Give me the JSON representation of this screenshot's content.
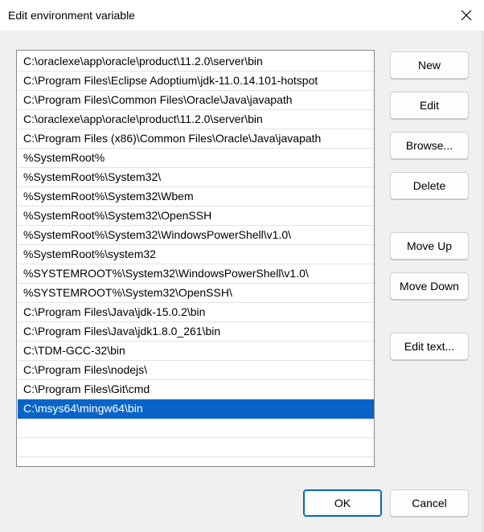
{
  "window": {
    "title": "Edit environment variable",
    "close_icon": "close-icon"
  },
  "path_entries": [
    "C:\\oraclexe\\app\\oracle\\product\\11.2.0\\server\\bin",
    "C:\\Program Files\\Eclipse Adoptium\\jdk-11.0.14.101-hotspot",
    "C:\\Program Files\\Common Files\\Oracle\\Java\\javapath",
    "C:\\oraclexe\\app\\oracle\\product\\11.2.0\\server\\bin",
    "C:\\Program Files (x86)\\Common Files\\Oracle\\Java\\javapath",
    "%SystemRoot%",
    "%SystemRoot%\\System32\\",
    "%SystemRoot%\\System32\\Wbem",
    "%SystemRoot%\\System32\\OpenSSH",
    "%SystemRoot%\\System32\\WindowsPowerShell\\v1.0\\",
    "%SystemRoot%\\system32",
    "%SYSTEMROOT%\\System32\\WindowsPowerShell\\v1.0\\",
    "%SYSTEMROOT%\\System32\\OpenSSH\\",
    "C:\\Program Files\\Java\\jdk-15.0.2\\bin",
    "C:\\Program Files\\Java\\jdk1.8.0_261\\bin",
    "C:\\TDM-GCC-32\\bin",
    "C:\\Program Files\\nodejs\\",
    "C:\\Program Files\\Git\\cmd",
    "C:\\msys64\\mingw64\\bin"
  ],
  "selected_entry": "C:\\msys64\\mingw64\\bin",
  "buttons": {
    "new": "New",
    "edit": "Edit",
    "browse": "Browse...",
    "delete": "Delete",
    "move_up": "Move Up",
    "move_down": "Move Down",
    "edit_text": "Edit text...",
    "ok": "OK",
    "cancel": "Cancel"
  },
  "colors": {
    "selection": "#0a64c8",
    "default_button_border": "#0067c0"
  }
}
